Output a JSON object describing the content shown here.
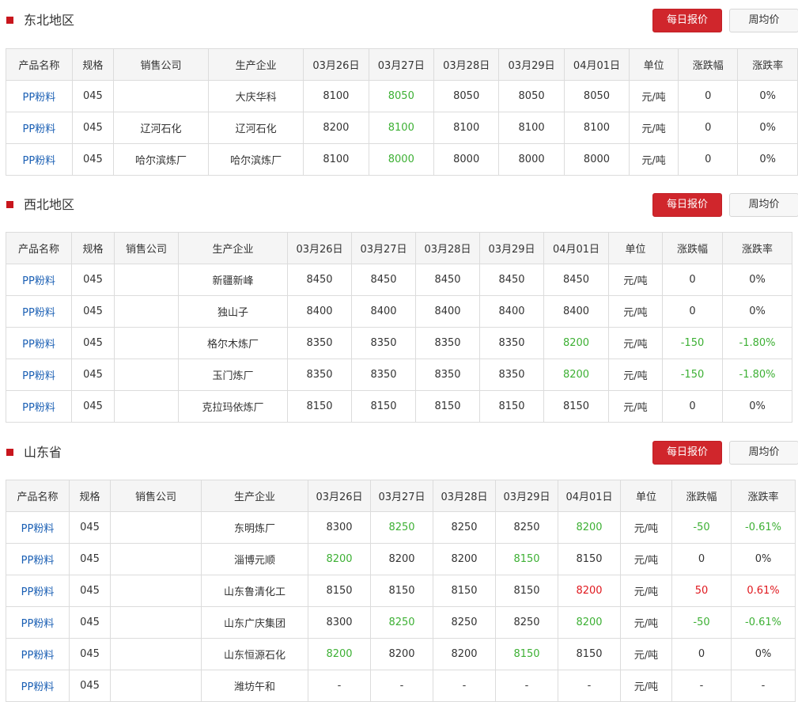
{
  "buttons": {
    "daily": "每日报价",
    "weekly": "周均价"
  },
  "colors": {
    "accent": "#d0262c",
    "up": "#e0191f",
    "down": "#3db034",
    "link": "#1a5fb4"
  },
  "sections": [
    {
      "title": "东北地区",
      "headers": [
        "产品名称",
        "规格",
        "销售公司",
        "生产企业",
        "03月26日",
        "03月27日",
        "03月28日",
        "03月29日",
        "04月01日",
        "单位",
        "涨跌幅",
        "涨跌率"
      ],
      "rows": [
        [
          "PP粉料",
          "045",
          "",
          "大庆华科",
          "8100",
          "8050",
          "8050",
          "8050",
          "8050",
          "元/吨",
          "0",
          "0%"
        ],
        [
          "PP粉料",
          "045",
          "辽河石化",
          "辽河石化",
          "8200",
          "8100",
          "8100",
          "8100",
          "8100",
          "元/吨",
          "0",
          "0%"
        ],
        [
          "PP粉料",
          "045",
          "哈尔滨炼厂",
          "哈尔滨炼厂",
          "8100",
          "8000",
          "8000",
          "8000",
          "8000",
          "元/吨",
          "0",
          "0%"
        ]
      ],
      "trend": [
        [
          "",
          "",
          "",
          "",
          "",
          "d",
          "",
          "",
          "",
          "",
          "",
          ""
        ],
        [
          "",
          "",
          "",
          "",
          "",
          "d",
          "",
          "",
          "",
          "",
          "",
          ""
        ],
        [
          "",
          "",
          "",
          "",
          "",
          "d",
          "",
          "",
          "",
          "",
          "",
          ""
        ]
      ]
    },
    {
      "title": "西北地区",
      "headers": [
        "产品名称",
        "规格",
        "销售公司",
        "生产企业",
        "03月26日",
        "03月27日",
        "03月28日",
        "03月29日",
        "04月01日",
        "单位",
        "涨跌幅",
        "涨跌率"
      ],
      "rows": [
        [
          "PP粉料",
          "045",
          "",
          "新疆新峰",
          "8450",
          "8450",
          "8450",
          "8450",
          "8450",
          "元/吨",
          "0",
          "0%"
        ],
        [
          "PP粉料",
          "045",
          "",
          "独山子",
          "8400",
          "8400",
          "8400",
          "8400",
          "8400",
          "元/吨",
          "0",
          "0%"
        ],
        [
          "PP粉料",
          "045",
          "",
          "格尔木炼厂",
          "8350",
          "8350",
          "8350",
          "8350",
          "8200",
          "元/吨",
          "-150",
          "-1.80%"
        ],
        [
          "PP粉料",
          "045",
          "",
          "玉门炼厂",
          "8350",
          "8350",
          "8350",
          "8350",
          "8200",
          "元/吨",
          "-150",
          "-1.80%"
        ],
        [
          "PP粉料",
          "045",
          "",
          "克拉玛依炼厂",
          "8150",
          "8150",
          "8150",
          "8150",
          "8150",
          "元/吨",
          "0",
          "0%"
        ]
      ],
      "trend": [
        [
          "",
          "",
          "",
          "",
          "",
          "",
          "",
          "",
          "",
          "",
          "",
          ""
        ],
        [
          "",
          "",
          "",
          "",
          "",
          "",
          "",
          "",
          "",
          "",
          "",
          ""
        ],
        [
          "",
          "",
          "",
          "",
          "",
          "",
          "",
          "",
          "d",
          "",
          "d",
          "d"
        ],
        [
          "",
          "",
          "",
          "",
          "",
          "",
          "",
          "",
          "d",
          "",
          "d",
          "d"
        ],
        [
          "",
          "",
          "",
          "",
          "",
          "",
          "",
          "",
          "",
          "",
          "",
          ""
        ]
      ]
    },
    {
      "title": "山东省",
      "headers": [
        "产品名称",
        "规格",
        "销售公司",
        "生产企业",
        "03月26日",
        "03月27日",
        "03月28日",
        "03月29日",
        "04月01日",
        "单位",
        "涨跌幅",
        "涨跌率"
      ],
      "rows": [
        [
          "PP粉料",
          "045",
          "",
          "东明炼厂",
          "8300",
          "8250",
          "8250",
          "8250",
          "8200",
          "元/吨",
          "-50",
          "-0.61%"
        ],
        [
          "PP粉料",
          "045",
          "",
          "淄博元顺",
          "8200",
          "8200",
          "8200",
          "8150",
          "8150",
          "元/吨",
          "0",
          "0%"
        ],
        [
          "PP粉料",
          "045",
          "",
          "山东鲁清化工",
          "8150",
          "8150",
          "8150",
          "8150",
          "8200",
          "元/吨",
          "50",
          "0.61%"
        ],
        [
          "PP粉料",
          "045",
          "",
          "山东广庆集团",
          "8300",
          "8250",
          "8250",
          "8250",
          "8200",
          "元/吨",
          "-50",
          "-0.61%"
        ],
        [
          "PP粉料",
          "045",
          "",
          "山东恒源石化",
          "8200",
          "8200",
          "8200",
          "8150",
          "8150",
          "元/吨",
          "0",
          "0%"
        ],
        [
          "PP粉料",
          "045",
          "",
          "潍坊午和",
          "-",
          "-",
          "-",
          "-",
          "-",
          "元/吨",
          "-",
          "-"
        ]
      ],
      "trend": [
        [
          "",
          "",
          "",
          "",
          "",
          "d",
          "",
          "",
          "d",
          "",
          "d",
          "d"
        ],
        [
          "",
          "",
          "",
          "",
          "d",
          "",
          "",
          "d",
          "",
          "",
          "",
          ""
        ],
        [
          "",
          "",
          "",
          "",
          "",
          "",
          "",
          "",
          "u",
          "",
          "u",
          "u"
        ],
        [
          "",
          "",
          "",
          "",
          "",
          "d",
          "",
          "",
          "d",
          "",
          "d",
          "d"
        ],
        [
          "",
          "",
          "",
          "",
          "d",
          "",
          "",
          "d",
          "",
          "",
          "",
          ""
        ],
        [
          "",
          "",
          "",
          "",
          "",
          "",
          "",
          "",
          "",
          "",
          "",
          ""
        ]
      ]
    }
  ]
}
